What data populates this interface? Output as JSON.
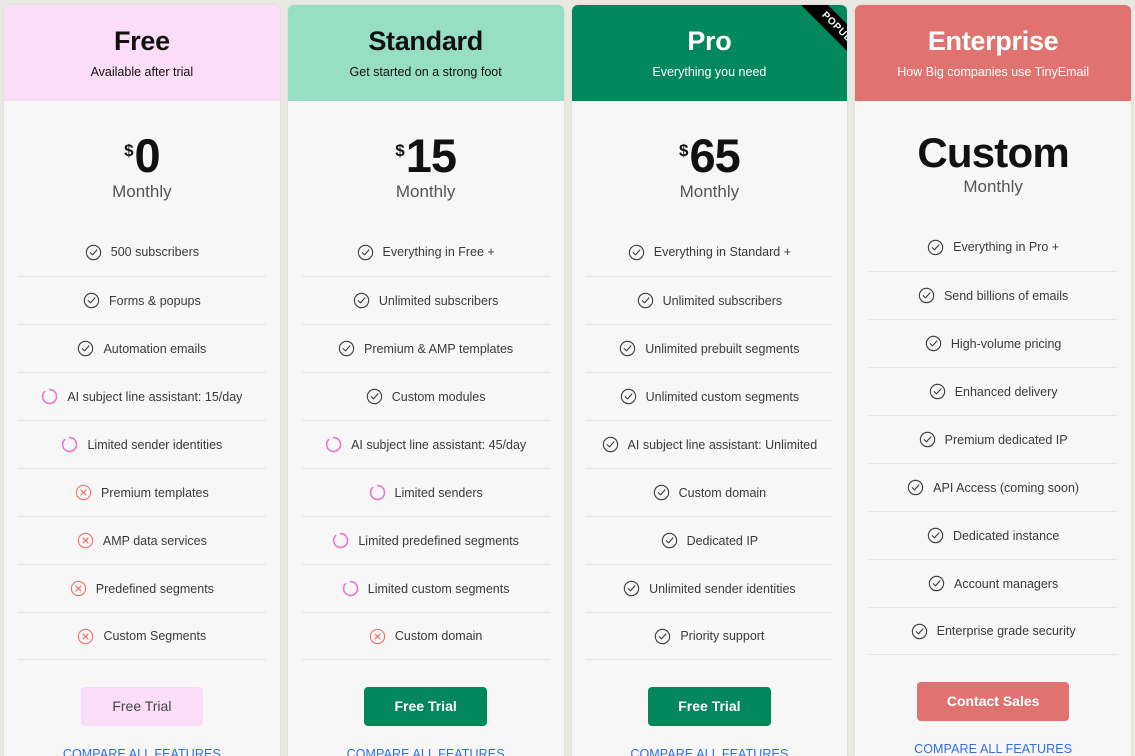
{
  "page": {
    "background": "#e9e9e4",
    "card_background": "#f7f7f7",
    "link_color": "#2f6fe4"
  },
  "icons": {
    "included": "check-circle-icon",
    "limited": "partial-circle-icon",
    "excluded": "x-circle-icon",
    "included_color": "#3c3c3c",
    "limited_color": "#e878c8",
    "excluded_color": "#f4736d"
  },
  "plans": [
    {
      "name": "Free",
      "tagline": "Available after trial",
      "header_bg": "#fbddf7",
      "header_text_color": "#111111",
      "currency": "$",
      "amount": "0",
      "period": "Monthly",
      "badge": null,
      "features": [
        {
          "label": "500 subscribers",
          "state": "included"
        },
        {
          "label": "Forms & popups",
          "state": "included"
        },
        {
          "label": "Automation emails",
          "state": "included"
        },
        {
          "label": "AI subject line assistant: 15/day",
          "state": "limited"
        },
        {
          "label": "Limited sender identities",
          "state": "limited"
        },
        {
          "label": "Premium templates",
          "state": "excluded"
        },
        {
          "label": "AMP data services",
          "state": "excluded"
        },
        {
          "label": "Predefined segments",
          "state": "excluded"
        },
        {
          "label": "Custom Segments",
          "state": "excluded"
        }
      ],
      "cta_label": "Free Trial",
      "cta_style": "cta-free",
      "compare_label": "COMPARE ALL FEATURES"
    },
    {
      "name": "Standard",
      "tagline": "Get started on a strong foot",
      "header_bg": "#96dfc4",
      "header_text_color": "#111111",
      "currency": "$",
      "amount": "15",
      "period": "Monthly",
      "badge": null,
      "features": [
        {
          "label": "Everything in Free +",
          "state": "included"
        },
        {
          "label": "Unlimited subscribers",
          "state": "included"
        },
        {
          "label": "Premium & AMP templates",
          "state": "included"
        },
        {
          "label": "Custom modules",
          "state": "included"
        },
        {
          "label": "AI subject line assistant: 45/day",
          "state": "limited"
        },
        {
          "label": "Limited senders",
          "state": "limited"
        },
        {
          "label": "Limited predefined segments",
          "state": "limited"
        },
        {
          "label": "Limited custom segments",
          "state": "limited"
        },
        {
          "label": "Custom domain",
          "state": "excluded"
        }
      ],
      "cta_label": "Free Trial",
      "cta_style": "cta-green",
      "compare_label": "COMPARE ALL FEATURES"
    },
    {
      "name": "Pro",
      "tagline": "Everything you need",
      "header_bg": "#03875d",
      "header_text_color": "#ffffff",
      "currency": "$",
      "amount": "65",
      "period": "Monthly",
      "badge": "POPULAR",
      "features": [
        {
          "label": "Everything in Standard +",
          "state": "included"
        },
        {
          "label": "Unlimited subscribers",
          "state": "included"
        },
        {
          "label": "Unlimited prebuilt segments",
          "state": "included"
        },
        {
          "label": "Unlimited custom segments",
          "state": "included"
        },
        {
          "label": "AI subject line assistant: Unlimited",
          "state": "included"
        },
        {
          "label": "Custom domain",
          "state": "included"
        },
        {
          "label": "Dedicated IP",
          "state": "included"
        },
        {
          "label": "Unlimited sender identities",
          "state": "included"
        },
        {
          "label": "Priority support",
          "state": "included"
        }
      ],
      "cta_label": "Free Trial",
      "cta_style": "cta-green",
      "compare_label": "COMPARE ALL FEATURES"
    },
    {
      "name": "Enterprise",
      "tagline": "How Big companies use TinyEmail",
      "header_bg": "#e0736f",
      "header_text_color": "#ffffff",
      "currency": "",
      "amount": "Custom",
      "period": "Monthly",
      "badge": null,
      "features": [
        {
          "label": "Everything in Pro +",
          "state": "included"
        },
        {
          "label": "Send billions of emails",
          "state": "included"
        },
        {
          "label": "High-volume pricing",
          "state": "included"
        },
        {
          "label": "Enhanced delivery",
          "state": "included"
        },
        {
          "label": "Premium dedicated IP",
          "state": "included"
        },
        {
          "label": "API Access (coming soon)",
          "state": "included"
        },
        {
          "label": "Dedicated instance",
          "state": "included"
        },
        {
          "label": "Account managers",
          "state": "included"
        },
        {
          "label": "Enterprise grade security",
          "state": "included"
        }
      ],
      "cta_label": "Contact Sales",
      "cta_style": "cta-red",
      "compare_label": "COMPARE ALL FEATURES"
    }
  ]
}
